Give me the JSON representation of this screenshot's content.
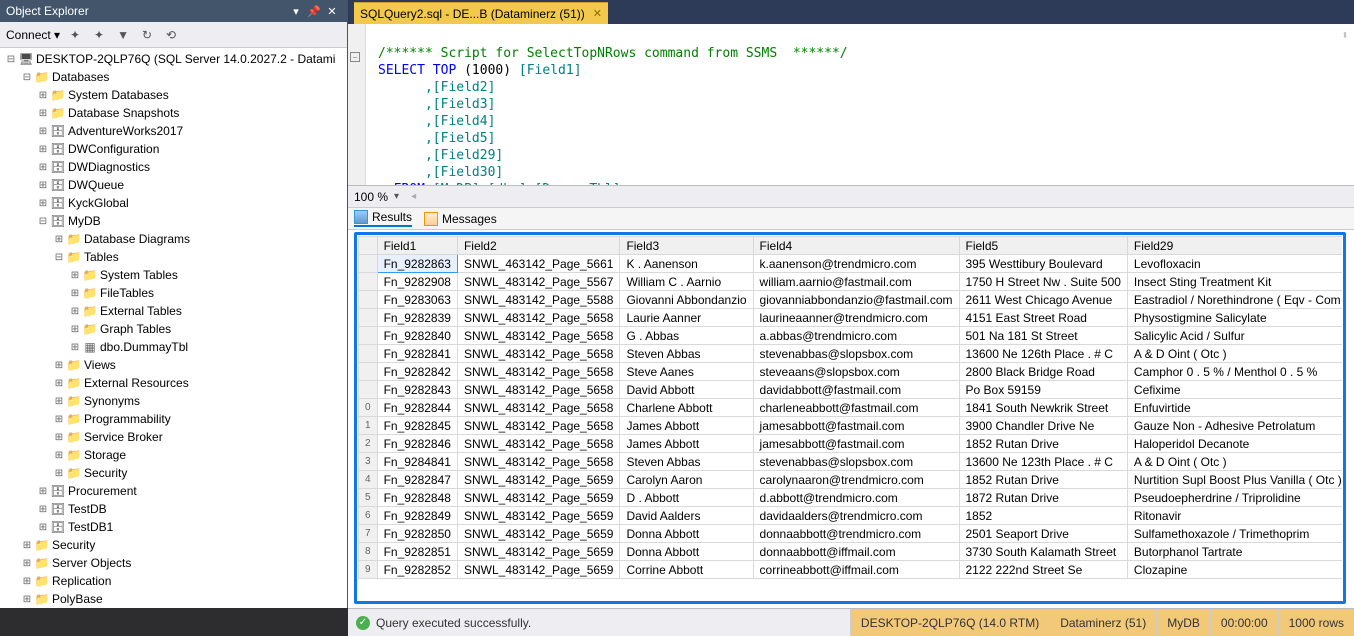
{
  "objectExplorer": {
    "title": "Object Explorer",
    "connect": "Connect",
    "tree": {
      "server": "DESKTOP-2QLP76Q (SQL Server 14.0.2027.2 - Datami",
      "databases": "Databases",
      "sysdb": "System Databases",
      "snapshots": "Database Snapshots",
      "adv": "AdventureWorks2017",
      "dwc": "DWConfiguration",
      "dwd": "DWDiagnostics",
      "dwq": "DWQueue",
      "kyck": "KyckGlobal",
      "mydb": "MyDB",
      "diagrams": "Database Diagrams",
      "tables": "Tables",
      "systables": "System Tables",
      "filetables": "FileTables",
      "exttables": "External Tables",
      "graphtables": "Graph Tables",
      "dummy": "dbo.DummayTbl",
      "views": "Views",
      "extres": "External Resources",
      "synonyms": "Synonyms",
      "prog": "Programmability",
      "sbroker": "Service Broker",
      "storage": "Storage",
      "security": "Security",
      "procurement": "Procurement",
      "testdb": "TestDB",
      "testdb1": "TestDB1",
      "security2": "Security",
      "serverobj": "Server Objects",
      "replication": "Replication",
      "polybase": "PolyBase"
    }
  },
  "tab": {
    "title": "SQLQuery2.sql - DE...B (Dataminerz (51))"
  },
  "editor": {
    "line1a": "/****** Script for SelectTopNRows command from SSMS  ******/",
    "line2_select": "SELECT",
    "line2_top": "TOP",
    "line2_num": "(1000)",
    "line2_f1": "[Field1]",
    "line3": ",[Field2]",
    "line4": ",[Field3]",
    "line5": ",[Field4]",
    "line6": ",[Field5]",
    "line7": ",[Field29]",
    "line8": ",[Field30]",
    "line9_from": "FROM",
    "line9_obj": "[MyDB].[dbo].[DummayTbl]"
  },
  "zoom": "100 %",
  "resultsTabs": {
    "results": "Results",
    "messages": "Messages"
  },
  "grid": {
    "headers": [
      "Field1",
      "Field2",
      "Field3",
      "Field4",
      "Field5",
      "Field29"
    ],
    "rows": [
      [
        "Fn_9282863",
        "SNWL_463142_Page_5661",
        "K . Aanenson",
        "k.aanenson@trendmicro.com",
        "395 Westtibury Boulevard",
        "Levofloxacin"
      ],
      [
        "Fn_9282908",
        "SNWL_483142_Page_5567",
        "William C . Aarnio",
        "william.aarnio@fastmail.com",
        "1750 H Street Nw . Suite 500",
        "Insect Sting Treatment Kit"
      ],
      [
        "Fn_9283063",
        "SNWL_483142_Page_5588",
        "Giovanni Abbondanzio",
        "giovanniabbondanzio@fastmail.com",
        "2611 West Chicago Avenue",
        "Eastradiol / Norethindrone ( Eqv - Com Bipatch"
      ],
      [
        "Fn_9282839",
        "SNWL_483142_Page_5658",
        "Laurie Aanner",
        "laurineaanner@trendmicro.com",
        "4151 East Street Road",
        "Physostigmine Salicylate"
      ],
      [
        "Fn_9282840",
        "SNWL_483142_Page_5658",
        "G . Abbas",
        "a.abbas@trendmicro.com",
        "501 Na 181 St Street",
        "Salicylic Acid / Sulfur"
      ],
      [
        "Fn_9282841",
        "SNWL_483142_Page_5658",
        "Steven Abbas",
        "stevenabbas@slopsbox.com",
        "13600 Ne 126th  Place . # C",
        "A & D Oint ( Otc )"
      ],
      [
        "Fn_9282842",
        "SNWL_483142_Page_5658",
        "Steve Aanes",
        "steveaans@slopsbox.com",
        "2800 Black Bridge Road",
        "Camphor 0 . 5 % / Menthol 0 . 5 %"
      ],
      [
        "Fn_9282843",
        "SNWL_483142_Page_5658",
        "David Abbott",
        "davidabbott@fastmail.com",
        "Po Box 59159",
        "Cefixime"
      ],
      [
        "Fn_9282844",
        "SNWL_483142_Page_5658",
        "Charlene Abbott",
        "charleneabbott@fastmail.com",
        "1841 South Newkrik Street",
        "Enfuvirtide"
      ],
      [
        "Fn_9282845",
        "SNWL_483142_Page_5658",
        "James Abbott",
        "jamesabbott@fastmail.com",
        "3900 Chandler Drive Ne",
        "Gauze Non - Adhesive Petrolatum"
      ],
      [
        "Fn_9282846",
        "SNWL_483142_Page_5658",
        "James Abbott",
        "jamesabbott@fastmail.com",
        "1852 Rutan Drive",
        "Haloperidol Decanote"
      ],
      [
        "Fn_9284841",
        "SNWL_483142_Page_5658",
        "Steven Abbas",
        "stevenabbas@slopsbox.com",
        "13600 Ne 123th Place . # C",
        "A & D Oint ( Otc )"
      ],
      [
        "Fn_9282847",
        "SNWL_483142_Page_5659",
        "Carolyn Aaron",
        "carolynaaron@trendmicro.com",
        "1852 Rutan Drive",
        "Nurtition Supl Boost Plus Vanilla ( Otc )"
      ],
      [
        "Fn_9282848",
        "SNWL_483142_Page_5659",
        "D . Abbott",
        "d.abbott@trendmicro.com",
        "1872 Rutan Drive",
        "Pseudoepherdrine / Triprolidine"
      ],
      [
        "Fn_9282849",
        "SNWL_483142_Page_5659",
        "David Aalders",
        "davidaalders@trendmicro.com",
        "1852",
        "Ritonavir"
      ],
      [
        "Fn_9282850",
        "SNWL_483142_Page_5659",
        "Donna Abbott",
        "donnaabbott@trendmicro.com",
        "2501 Seaport Drive",
        "Sulfamethoxazole / Trimethoprim"
      ],
      [
        "Fn_9282851",
        "SNWL_483142_Page_5659",
        "Donna Abbott",
        "donnaabbott@iffmail.com",
        "3730 South Kalamath Street",
        "Butorphanol Tartrate"
      ],
      [
        "Fn_9282852",
        "SNWL_483142_Page_5659",
        "Corrine Abbott",
        "corrineabbott@iffmail.com",
        "2122 222nd Street Se",
        "Clozapine"
      ]
    ]
  },
  "status": {
    "msg": "Query executed successfully.",
    "server": "DESKTOP-2QLP76Q (14.0 RTM)",
    "user": "Dataminerz (51)",
    "db": "MyDB",
    "time": "00:00:00",
    "rows": "1000 rows"
  }
}
